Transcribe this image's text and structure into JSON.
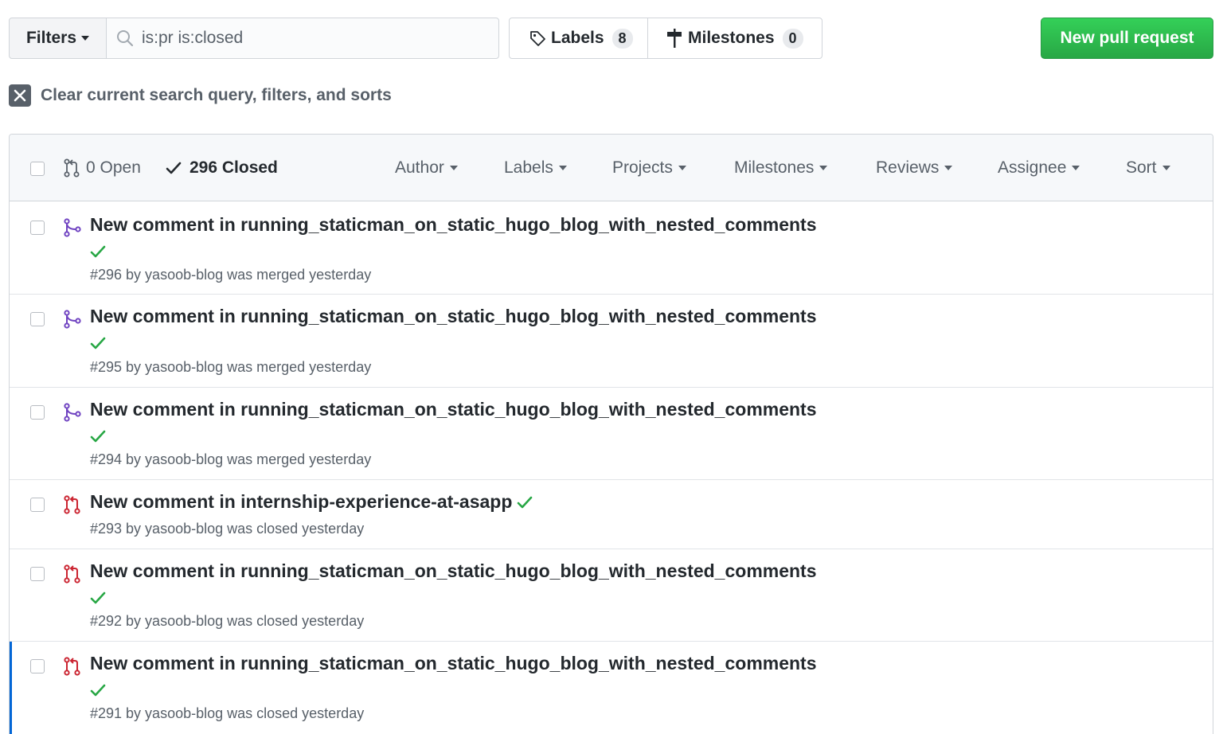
{
  "toolbar": {
    "filters_label": "Filters",
    "search_value": "is:pr is:closed",
    "labels_label": "Labels",
    "labels_count": "8",
    "milestones_label": "Milestones",
    "milestones_count": "0",
    "new_pr_label": "New pull request",
    "new_pr_color": "#2ea44f"
  },
  "clear": {
    "text": "Clear current search query, filters, and sorts"
  },
  "header": {
    "open_label": "0 Open",
    "closed_label": "296 Closed",
    "filters": [
      "Author",
      "Labels",
      "Projects",
      "Milestones",
      "Reviews",
      "Assignee",
      "Sort"
    ]
  },
  "pull_requests": [
    {
      "title": "New comment in running_staticman_on_static_hugo_blog_with_nested_comments",
      "meta": "#296 by yasoob-blog was merged yesterday",
      "state": "merged"
    },
    {
      "title": "New comment in running_staticman_on_static_hugo_blog_with_nested_comments",
      "meta": "#295 by yasoob-blog was merged yesterday",
      "state": "merged"
    },
    {
      "title": "New comment in running_staticman_on_static_hugo_blog_with_nested_comments",
      "meta": "#294 by yasoob-blog was merged yesterday",
      "state": "merged"
    },
    {
      "title": "New comment in internship-experience-at-asapp",
      "meta": "#293 by yasoob-blog was closed yesterday",
      "state": "closed"
    },
    {
      "title": "New comment in running_staticman_on_static_hugo_blog_with_nested_comments",
      "meta": "#292 by yasoob-blog was closed yesterday",
      "state": "closed"
    },
    {
      "title": "New comment in running_staticman_on_static_hugo_blog_with_nested_comments",
      "meta": "#291 by yasoob-blog was closed yesterday",
      "state": "closed"
    }
  ],
  "colors": {
    "merged": "#6f42c1",
    "closed": "#cb2431",
    "success": "#28a745",
    "selected_bar": "#0366d6"
  }
}
